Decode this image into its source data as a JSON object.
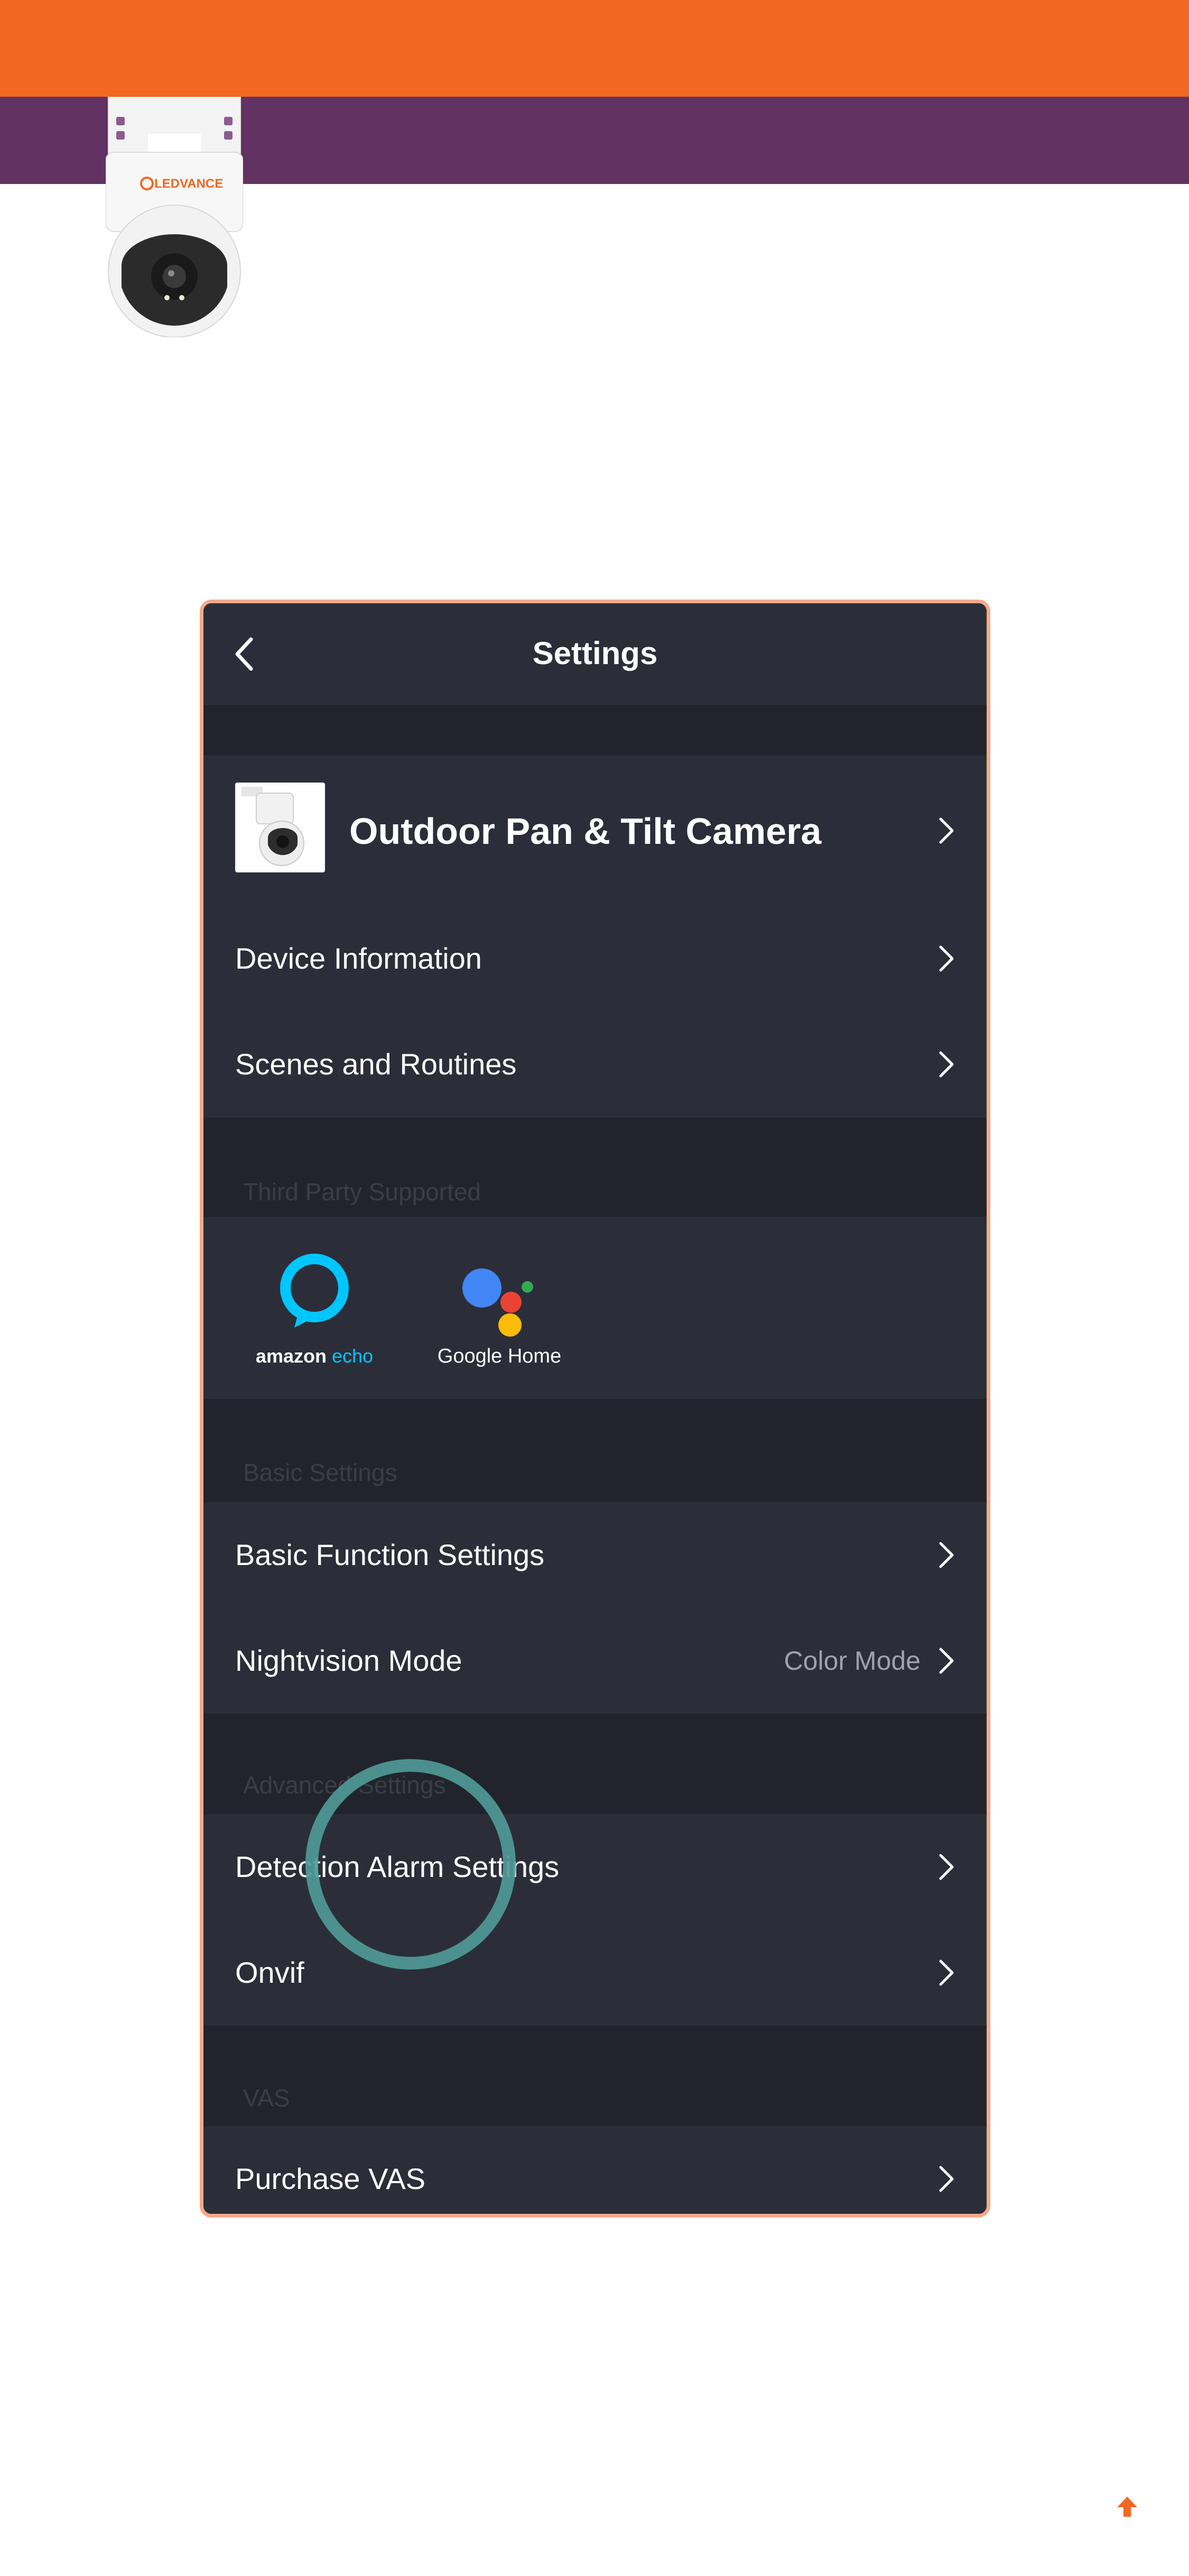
{
  "page": {
    "colors": {
      "brand_orange": "#f26722",
      "brand_purple": "#613262",
      "panel_border": "#f6a98a",
      "tap_ring": "#4f9a97"
    },
    "hero_image": {
      "icon": "outdoor-camera-image",
      "brand_text": "LEDVANCE"
    },
    "scroll_top_icon": "arrow-up-icon"
  },
  "settings": {
    "nav": {
      "title": "Settings",
      "back_icon": "chevron-left-icon"
    },
    "device": {
      "name": "Outdoor Pan & Tilt Camera",
      "thumb_icon": "camera-thumbnail"
    },
    "device_rows": [
      {
        "label": "Device Information"
      },
      {
        "label": "Scenes and Routines"
      }
    ],
    "third_party": {
      "header": "Third Party Supported",
      "alexa": {
        "brand": "amazon",
        "product": "echo"
      },
      "google": {
        "label": "Google Home"
      }
    },
    "basic": {
      "header": "Basic Settings",
      "rows": [
        {
          "label": "Basic Function Settings"
        },
        {
          "label": "Nightvision Mode",
          "value": "Color Mode"
        }
      ]
    },
    "advanced": {
      "header": "Advanced Settings",
      "rows": [
        {
          "label": "Detection Alarm Settings"
        },
        {
          "label": "Onvif"
        }
      ]
    },
    "vas": {
      "header": "VAS",
      "rows": [
        {
          "label": "Purchase VAS"
        }
      ]
    }
  }
}
